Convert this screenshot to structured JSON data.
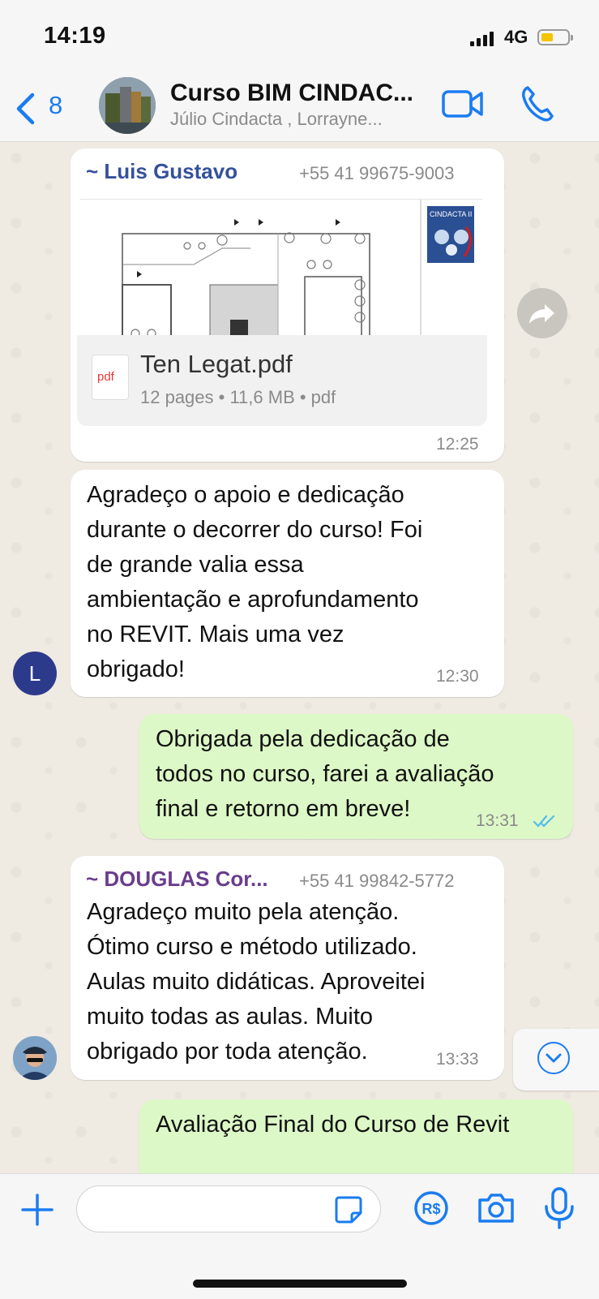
{
  "status_bar": {
    "time": "14:19",
    "network": "4G",
    "battery_color": "#f5c400"
  },
  "header": {
    "back_count": "8",
    "title": "Curso BIM CINDAC...",
    "subtitle": "Júlio Cindacta , Lorrayne...",
    "accent": "#1a7cf2"
  },
  "messages": [
    {
      "sender": "~ Luis Gustavo",
      "phone": "+55 41 99675-9003",
      "name_color": "#35519c",
      "document": {
        "icon_label": "pdf",
        "name": "Ten Legat.pdf",
        "meta": "12 pages • 11,6 MB • pdf",
        "stamp": "CINDACTA II"
      },
      "time": "12:25"
    },
    {
      "avatar": "L",
      "lines": [
        "Agradeço o apoio e dedicação",
        "durante o decorrer do curso! Foi",
        "de grande valia essa",
        "ambientação e aprofundamento",
        "no REVIT. Mais uma vez",
        "obrigado!"
      ],
      "time": "12:30"
    },
    {
      "outgoing": true,
      "lines": [
        "Obrigada pela dedicação de",
        "todos no curso, farei a avaliação",
        "final e retorno em breve!"
      ],
      "time": "13:31",
      "receipt": "read",
      "receipt_color": "#53bdeb"
    },
    {
      "sender": "~ DOUGLAS Cor...",
      "phone": "+55 41 99842-5772",
      "name_color": "#6a3d8c",
      "lines": [
        "Agradeço muito pela atenção.",
        "Ótimo curso e método utilizado.",
        "Aulas muito didáticas. Aproveitei",
        "muito todas as aulas. Muito",
        "obrigado por toda atenção."
      ],
      "time": "13:33"
    },
    {
      "outgoing": true,
      "lines": [
        "Avaliação Final do Curso de Revit"
      ]
    }
  ],
  "input": {
    "placeholder": "",
    "value": "",
    "pay_label": "R$"
  }
}
